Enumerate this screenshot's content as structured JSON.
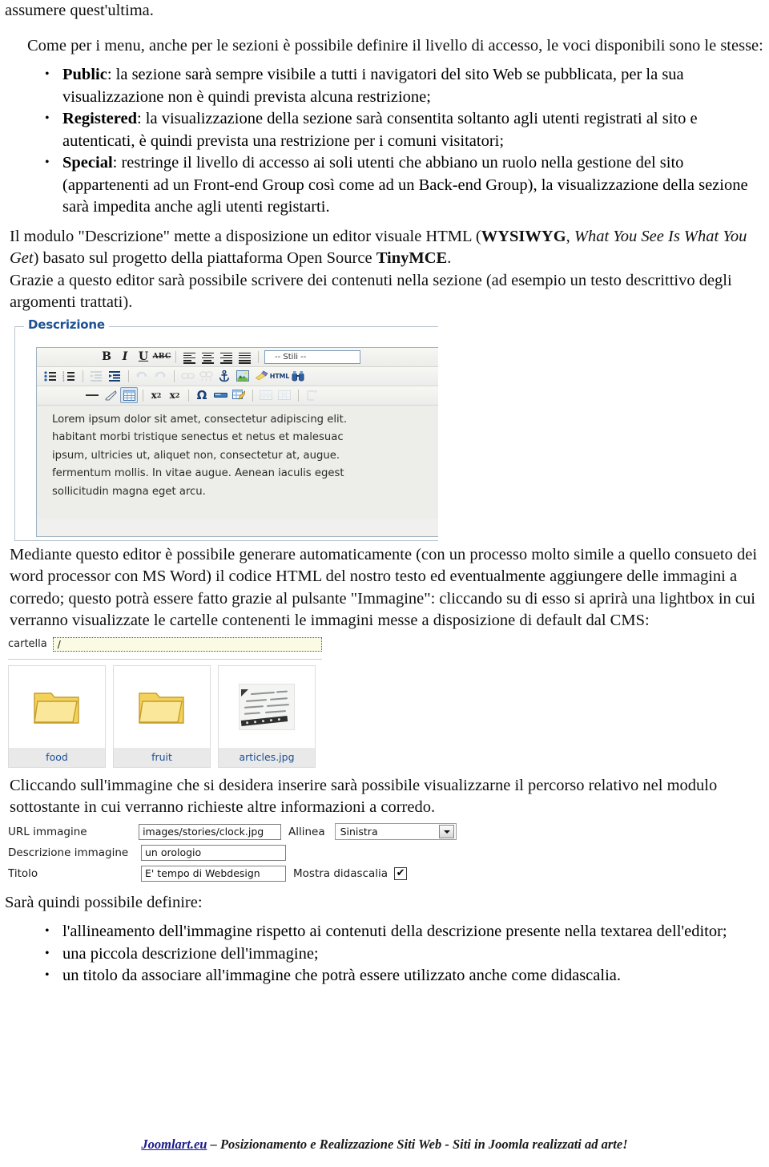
{
  "document": {
    "intro_fragment": "assumere quest'ultima.",
    "paragraph_access": "Come per i menu, anche per le sezioni è possibile definire il livello di accesso, le voci disponibili sono le stesse:",
    "access_levels": [
      {
        "term": "Public",
        "text": ": la sezione sarà sempre visibile a tutti i navigatori del sito Web se pubblicata, per la sua visualizzazione non è quindi prevista alcuna restrizione;"
      },
      {
        "term": "Registered",
        "text": ": la visualizzazione della sezione sarà consentita soltanto agli utenti registrati al sito e autenticati, è quindi prevista una restrizione per i comuni visitatori;"
      },
      {
        "term": "Special",
        "text": ": restringe il livello di accesso ai soli utenti che abbiano un ruolo nella gestione del sito (appartenenti ad un Front-end Group così come ad un Back-end Group), la visualizzazione della sezione sarà impedita anche agli utenti registarti."
      }
    ],
    "paragraph_editor_a": "Il modulo \"Descrizione\" mette a disposizione un editor visuale HTML (",
    "paragraph_editor_bold": "WYSIWYG",
    "paragraph_editor_b": ", ",
    "paragraph_editor_italic": "What You See Is What You Get",
    "paragraph_editor_c": ") basato sul progetto della piattaforma Open Source ",
    "paragraph_editor_bold2": "TinyMCE",
    "paragraph_editor_d": ".",
    "paragraph_editor_e": "Grazie a questo editor sarà possibile scrivere dei contenuti nella sezione (ad esempio un testo descrittivo degli argomenti trattati).",
    "paragraph_generate": "Mediante questo editor è possibile generare automaticamente (con un processo molto simile a quello consueto dei word processor con MS Word) il codice HTML del nostro testo ed eventualmente aggiungere delle immagini a corredo; questo potrà essere fatto grazie al pulsante \"Immagine\": cliccando su di esso si aprirà una lightbox in cui verranno visualizzate le cartelle contenenti le immagini messe a disposizione di default dal CMS:",
    "paragraph_click": "Cliccando sull'immagine che si desidera inserire sarà possibile visualizzarne il percorso relativo nel modulo sottostante in cui verranno richieste altre informazioni a corredo.",
    "paragraph_define": "Sarà quindi possibile definire:",
    "define_items": [
      "l'allineamento dell'immagine rispetto ai contenuti della descrizione presente nella textarea dell'editor;",
      "una piccola descrizione dell'immagine;",
      "un titolo da associare all'immagine che potrà essere utilizzato anche come didascalia."
    ]
  },
  "editor_screenshot": {
    "legend": "Descrizione",
    "toolbar_row1": [
      {
        "name": "bold-button",
        "glyph": "B",
        "kind": "bold"
      },
      {
        "name": "italic-button",
        "glyph": "I",
        "kind": "italic"
      },
      {
        "name": "underline-button",
        "glyph": "U",
        "kind": "underline"
      },
      {
        "name": "strikethrough-button",
        "glyph": "ABC",
        "kind": "strike"
      },
      {
        "name": "separator",
        "glyph": "",
        "kind": "sep"
      },
      {
        "name": "align-left-button",
        "glyph": "",
        "kind": "align-left"
      },
      {
        "name": "align-center-button",
        "glyph": "",
        "kind": "align-center"
      },
      {
        "name": "align-right-button",
        "glyph": "",
        "kind": "align-right"
      },
      {
        "name": "align-justify-button",
        "glyph": "",
        "kind": "align-justify"
      },
      {
        "name": "separator",
        "glyph": "",
        "kind": "sep"
      }
    ],
    "styles_select_value": "-- Stili --",
    "toolbar_row2": [
      {
        "name": "bullet-list-button",
        "glyph": "☰",
        "kind": "ul"
      },
      {
        "name": "numbered-list-button",
        "glyph": "☰",
        "kind": "ol"
      },
      {
        "name": "separator",
        "glyph": "",
        "kind": "sep"
      },
      {
        "name": "outdent-button",
        "glyph": "",
        "kind": "outdent",
        "disabled": true
      },
      {
        "name": "indent-button",
        "glyph": "",
        "kind": "indent"
      },
      {
        "name": "separator",
        "glyph": "",
        "kind": "sep"
      },
      {
        "name": "undo-button",
        "glyph": "↶",
        "kind": "undo",
        "disabled": true
      },
      {
        "name": "redo-button",
        "glyph": "↷",
        "kind": "redo",
        "disabled": true
      },
      {
        "name": "separator",
        "glyph": "",
        "kind": "sep"
      },
      {
        "name": "insert-link-button",
        "glyph": "⚭",
        "kind": "link",
        "disabled": true
      },
      {
        "name": "unlink-button",
        "glyph": "⚭",
        "kind": "unlink",
        "disabled": true
      },
      {
        "name": "anchor-button",
        "glyph": "⚓",
        "kind": "anchor"
      },
      {
        "name": "insert-image-button",
        "glyph": "",
        "kind": "image"
      },
      {
        "name": "cleanup-button",
        "glyph": "",
        "kind": "broom"
      },
      {
        "name": "edit-html-button",
        "glyph": "HTML",
        "kind": "html"
      },
      {
        "name": "search-button",
        "glyph": "",
        "kind": "binoculars"
      }
    ],
    "toolbar_row3": [
      {
        "name": "horizontal-rule-button",
        "glyph": "—",
        "kind": "hr"
      },
      {
        "name": "remove-format-button",
        "glyph": "",
        "kind": "eraser"
      },
      {
        "name": "toggle-guidelines-button",
        "glyph": "",
        "kind": "grid",
        "selected": true
      },
      {
        "name": "separator",
        "glyph": "",
        "kind": "sep"
      },
      {
        "name": "subscript-button",
        "glyph": "x",
        "kind": "sub"
      },
      {
        "name": "superscript-button",
        "glyph": "x",
        "kind": "sup"
      },
      {
        "name": "separator",
        "glyph": "",
        "kind": "sep"
      },
      {
        "name": "special-character-button",
        "glyph": "Ω",
        "kind": "omega"
      },
      {
        "name": "insert-page-break-button",
        "glyph": "",
        "kind": "pagebreak"
      },
      {
        "name": "insert-table-button",
        "glyph": "",
        "kind": "table-edit"
      },
      {
        "name": "separator",
        "glyph": "",
        "kind": "sep"
      },
      {
        "name": "table-row-properties-button",
        "glyph": "",
        "kind": "table-row",
        "disabled": true
      },
      {
        "name": "table-cell-properties-button",
        "glyph": "",
        "kind": "table-cell",
        "disabled": true
      },
      {
        "name": "separator",
        "glyph": "",
        "kind": "sep"
      },
      {
        "name": "insert-row-before-button",
        "glyph": "",
        "kind": "row-before",
        "disabled": true
      }
    ],
    "content_lines": [
      "Lorem ipsum dolor sit amet, consectetur adipiscing elit.",
      "habitant morbi tristique senectus et netus et malesuac",
      "ipsum, ultricies ut, aliquet non, consectetur at, augue.",
      "fermentum mollis. In vitae augue. Aenean iaculis egest",
      "sollicitudin magna eget arcu."
    ]
  },
  "browser_screenshot": {
    "path_label": "cartella",
    "path_value": "/",
    "items": [
      {
        "label": "food",
        "type": "folder"
      },
      {
        "label": "fruit",
        "type": "folder"
      },
      {
        "label": "articles.jpg",
        "type": "image"
      }
    ]
  },
  "image_form": {
    "rows": [
      {
        "label": "URL immagine",
        "value": "images/stories/clock.jpg",
        "extra_label": "Allinea",
        "select_value": "Sinistra"
      },
      {
        "label": "Descrizione immagine",
        "value": "un orologio"
      },
      {
        "label": "Titolo",
        "value": "E' tempo di Webdesign",
        "extra_label": "Mostra didascalia",
        "checkbox_checked": true,
        "check_glyph": "✔"
      }
    ]
  },
  "footer": {
    "link": "Joomlart.eu",
    "text": " –  Posizionamento e Realizzazione Siti Web - Siti in Joomla realizzati ad arte!"
  },
  "colors": {
    "legend_blue": "#1c4f93",
    "link_blue": "#1b1b8f",
    "field_yellow": "#fbfbe4"
  }
}
